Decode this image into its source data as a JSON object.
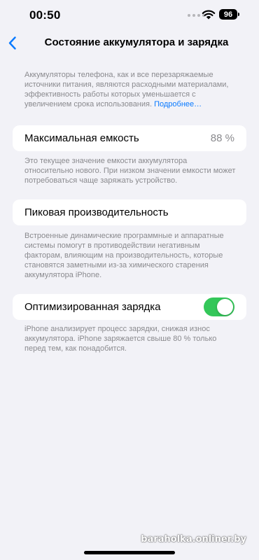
{
  "status_bar": {
    "time": "00:50",
    "battery_level": "96",
    "wifi_icon": "wifi-icon"
  },
  "nav": {
    "back_icon": "chevron-left-icon",
    "title": "Состояние аккумулятора и зарядка"
  },
  "intro": {
    "text": "Аккумуляторы телефона, как и все перезаряжаемые источники питания, являются расходными материалами, эффективность работы которых уменьшается с увеличением срока использования.",
    "link_label": "Подробнее…"
  },
  "max_capacity": {
    "label": "Максимальная емкость",
    "value": "88 %",
    "footnote": "Это текущее значение емкости аккумулятора относительно нового. При низком значении емкости может потребоваться чаще заряжать устройство."
  },
  "peak_performance": {
    "label": "Пиковая производительность",
    "footnote": "Встроенные динамические программные и аппаратные системы помогут в противодействии негативным факторам, влияющим на производительность, которые становятся заметными из-за химического старения аккумулятора iPhone."
  },
  "optimized_charging": {
    "label": "Оптимизированная зарядка",
    "enabled": true,
    "toggle_color": "#34c759",
    "footnote": "iPhone анализирует процесс зарядки, снижая износ аккумулятора. iPhone заряжается свыше 80 % только перед тем, как понадобится."
  },
  "watermark": "baraholka.onliner.by"
}
